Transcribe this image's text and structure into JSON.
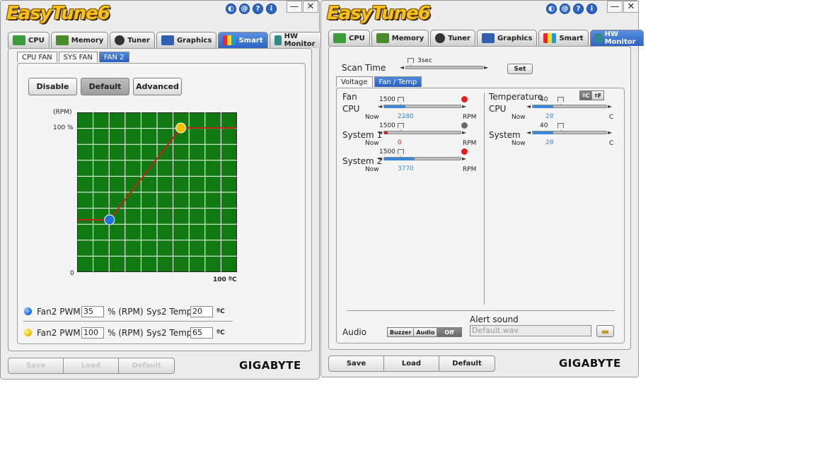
{
  "app": {
    "logo": "EasyTune6",
    "brand": "GIGABYTE"
  },
  "header_icons": [
    "◐",
    "@",
    "?",
    "i"
  ],
  "window_buttons": {
    "minimize": "—",
    "close": "✕"
  },
  "tabs": [
    {
      "label": "CPU",
      "icon": "cpu-icon"
    },
    {
      "label": "Memory",
      "icon": "memory-icon"
    },
    {
      "label": "Tuner",
      "icon": "tuner-icon"
    },
    {
      "label": "Graphics",
      "icon": "graphics-icon"
    },
    {
      "label": "Smart",
      "icon": "smart-icon"
    },
    {
      "label": "HW Monitor",
      "icon": "hw-monitor-icon"
    }
  ],
  "left": {
    "active_tab": "Smart",
    "subtabs": [
      "CPU FAN",
      "SYS FAN",
      "FAN 2"
    ],
    "active_subtab": "FAN 2",
    "mode_buttons": [
      "Disable",
      "Default",
      "Advanced"
    ],
    "active_mode": "Default",
    "chart_data": {
      "type": "line",
      "y_unit_label": "(RPM)",
      "y_max_label": "100 %",
      "origin_label": "0",
      "x_max_label": "100 ºC",
      "xlim": [
        0,
        100
      ],
      "ylim": [
        0,
        100
      ],
      "points": [
        [
          0,
          35
        ],
        [
          20,
          35
        ],
        [
          65,
          100
        ],
        [
          100,
          100
        ]
      ],
      "control_points": [
        {
          "x": 20,
          "y": 35,
          "color": "#1e6fe0"
        },
        {
          "x": 65,
          "y": 100,
          "color": "#f2c200"
        }
      ],
      "grid": true,
      "background": "#127a12",
      "line_color": "#c0241b"
    },
    "rows": [
      {
        "label": "Fan2 PWM",
        "pwm": "35",
        "unit": "% (RPM)",
        "temp_label": "Sys2 Temp",
        "temp": "20",
        "temp_unit": "ºC",
        "dot_color": "#1e6fe0"
      },
      {
        "label": "Fan2 PWM",
        "pwm": "100",
        "unit": "% (RPM)",
        "temp_label": "Sys2 Temp",
        "temp": "65",
        "temp_unit": "ºC",
        "dot_color": "#f2c200"
      }
    ],
    "bottom_buttons": [
      "Save",
      "Load",
      "Default"
    ]
  },
  "right": {
    "active_tab": "HW Monitor",
    "scan_time": {
      "label": "Scan Time",
      "value": "3sec",
      "set_label": "Set"
    },
    "subtabs": [
      "Voltage",
      "Fan / Temp"
    ],
    "active_subtab": "Fan / Temp",
    "fan": {
      "title": "Fan",
      "now_label": "Now",
      "unit": "RPM",
      "items": [
        {
          "label": "CPU",
          "threshold": "1500",
          "now": "2280",
          "level": 0.28,
          "fill_color": "#3a8ad8",
          "alert_color": "#e02020"
        },
        {
          "label": "System 1",
          "threshold": "1500",
          "now": "0",
          "level": 0.05,
          "fill_color": "#e02020",
          "alert_color": "#6a6a6a"
        },
        {
          "label": "System 2",
          "threshold": "1500",
          "now": "3770",
          "level": 0.4,
          "fill_color": "#3a8ad8",
          "alert_color": "#e02020"
        }
      ]
    },
    "temperature": {
      "title": "Temperature",
      "unit_c": "ºC",
      "unit_f": "ºF",
      "now_label": "Now",
      "unit": "C",
      "items": [
        {
          "label": "CPU",
          "threshold": "40",
          "now": "28",
          "level": 0.28
        },
        {
          "label": "System",
          "threshold": "40",
          "now": "28",
          "level": 0.28
        }
      ]
    },
    "audio": {
      "label": "Audio",
      "options": [
        "Buzzer",
        "Audio",
        "Off"
      ],
      "active": "Off",
      "alert_sound_label": "Alert sound",
      "alert_sound_value": "Default.wav"
    },
    "bottom_buttons": [
      "Save",
      "Load",
      "Default"
    ]
  }
}
